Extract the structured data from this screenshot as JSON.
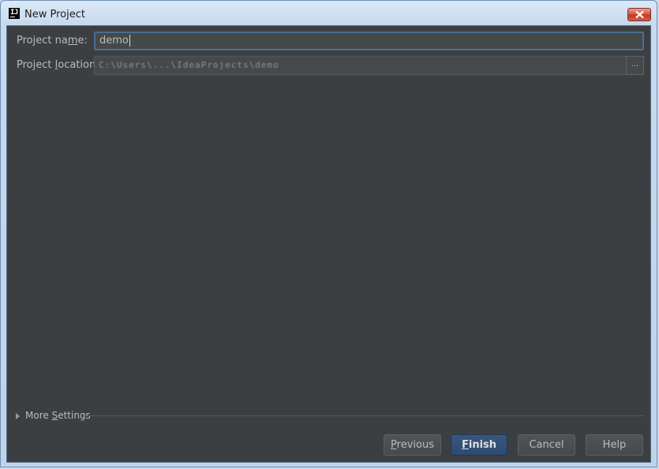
{
  "window": {
    "title": "New Project"
  },
  "form": {
    "project_name": {
      "label_before": "Project na",
      "label_underlined": "m",
      "label_after": "e:",
      "value": "demo"
    },
    "project_location": {
      "label_before": "Project ",
      "label_underlined": "l",
      "label_after": "ocation:",
      "value": "C:\\Users\\...\\IdeaProjects\\demo",
      "browse_label": "..."
    }
  },
  "more_settings": {
    "label_before": "More ",
    "label_underlined": "S",
    "label_after": "ettings"
  },
  "buttons": {
    "previous": {
      "underlined": "P",
      "rest": "revious"
    },
    "finish": {
      "underlined": "F",
      "rest": "inish"
    },
    "cancel": "Cancel",
    "help": "Help"
  }
}
